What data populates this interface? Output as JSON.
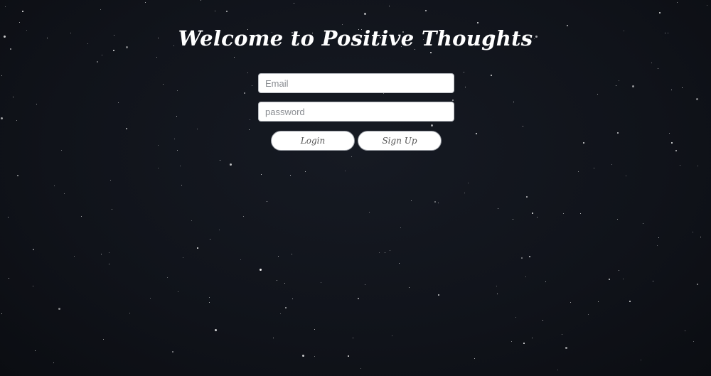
{
  "page": {
    "title": "Welcome to Positive Thoughts"
  },
  "login_form": {
    "email_placeholder": "Email",
    "email_value": "",
    "password_placeholder": "password",
    "password_value": "",
    "login_label": "Login",
    "signup_label": "Sign Up"
  },
  "colors": {
    "background": "#11141b",
    "star": "#ffffff",
    "title_text": "#ffffff"
  }
}
